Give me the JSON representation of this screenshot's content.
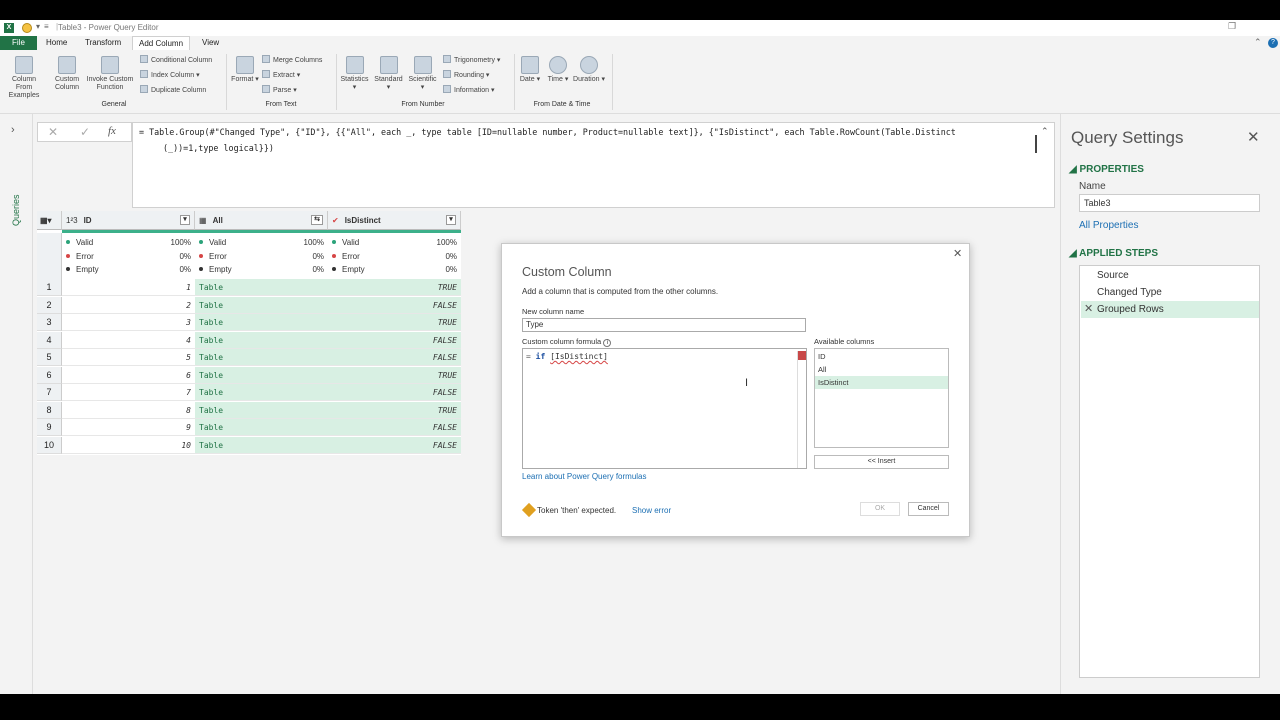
{
  "app": {
    "window_title": "Table3 - Power Query Editor",
    "icons": [
      "excel-icon",
      "smiley-icon",
      "undo-icon"
    ]
  },
  "tabs": [
    {
      "label": "File"
    },
    {
      "label": "Home"
    },
    {
      "label": "Transform"
    },
    {
      "label": "Add Column"
    },
    {
      "label": "View"
    }
  ],
  "ribbon": {
    "general": {
      "label": "General",
      "column_from_examples": "Column From Examples",
      "custom_column": "Custom Column",
      "invoke_custom_function": "Invoke Custom Function",
      "conditional_column": "Conditional Column",
      "index_column": "Index Column",
      "duplicate_column": "Duplicate Column"
    },
    "from_text": {
      "label": "From Text",
      "format": "Format",
      "merge_columns": "Merge Columns",
      "extract": "Extract",
      "parse": "Parse"
    },
    "from_number": {
      "label": "From Number",
      "statistics": "Statistics",
      "standard": "Standard",
      "scientific": "Scientific",
      "trigonometry": "Trigonometry",
      "rounding": "Rounding",
      "information": "Information"
    },
    "from_date_time": {
      "label": "From Date & Time",
      "date": "Date",
      "time": "Time",
      "duration": "Duration"
    }
  },
  "left_panel": {
    "queries_label": "Queries"
  },
  "formula_bar": {
    "cancel": "✕",
    "accept": "✓",
    "fx": "fx",
    "line1": "= Table.Group(#\"Changed Type\", {\"ID\"}, {{\"All\", each _, type table [ID=nullable number, Product=nullable text]}, {\"IsDistinct\", each Table.RowCount(Table.Distinct",
    "line2": "(_))=1,type logical}})"
  },
  "grid": {
    "columns": [
      {
        "type_icon": "1²3",
        "name": "ID"
      },
      {
        "type_icon": "▦",
        "name": "All"
      },
      {
        "type_icon": "✔",
        "name": "IsDistinct"
      }
    ],
    "stats": [
      {
        "valid": "100%",
        "error": "0%",
        "empty": "0%"
      },
      {
        "valid": "100%",
        "error": "0%",
        "empty": "0%"
      },
      {
        "valid": "100%",
        "error": "0%",
        "empty": "0%"
      }
    ],
    "stat_labels": {
      "valid": "Valid",
      "error": "Error",
      "empty": "Empty"
    },
    "rows": [
      {
        "n": "1",
        "id": "1",
        "all": "Table",
        "d": "TRUE"
      },
      {
        "n": "2",
        "id": "2",
        "all": "Table",
        "d": "FALSE"
      },
      {
        "n": "3",
        "id": "3",
        "all": "Table",
        "d": "TRUE"
      },
      {
        "n": "4",
        "id": "4",
        "all": "Table",
        "d": "FALSE"
      },
      {
        "n": "5",
        "id": "5",
        "all": "Table",
        "d": "FALSE"
      },
      {
        "n": "6",
        "id": "6",
        "all": "Table",
        "d": "TRUE"
      },
      {
        "n": "7",
        "id": "7",
        "all": "Table",
        "d": "FALSE"
      },
      {
        "n": "8",
        "id": "8",
        "all": "Table",
        "d": "TRUE"
      },
      {
        "n": "9",
        "id": "9",
        "all": "Table",
        "d": "FALSE"
      },
      {
        "n": "10",
        "id": "10",
        "all": "Table",
        "d": "FALSE"
      }
    ]
  },
  "dialog": {
    "title": "Custom Column",
    "subtitle": "Add a column that is computed from the other columns.",
    "name_label": "New column name",
    "name_value": "Type",
    "formula_label": "Custom column formula",
    "formula_eq": "=",
    "formula_kw": "if",
    "formula_ref": "[IsDistinct]",
    "available_label": "Available columns",
    "available": [
      "ID",
      "All",
      "IsDistinct"
    ],
    "insert": "<< Insert",
    "learn": "Learn about Power Query formulas",
    "error": "Token 'then' expected.",
    "show_error": "Show error",
    "ok": "OK",
    "cancel": "Cancel"
  },
  "settings": {
    "title": "Query Settings",
    "properties": "PROPERTIES",
    "name_label": "Name",
    "name_value": "Table3",
    "all_properties": "All Properties",
    "applied_steps": "APPLIED STEPS",
    "steps": [
      "Source",
      "Changed Type",
      "Grouped Rows"
    ]
  },
  "colors": {
    "accent": "#217346",
    "valid": "#2ba37a",
    "error": "#d64545",
    "empty": "#333333",
    "highlight": "#d8f0e3",
    "link": "#1c6fb3"
  }
}
